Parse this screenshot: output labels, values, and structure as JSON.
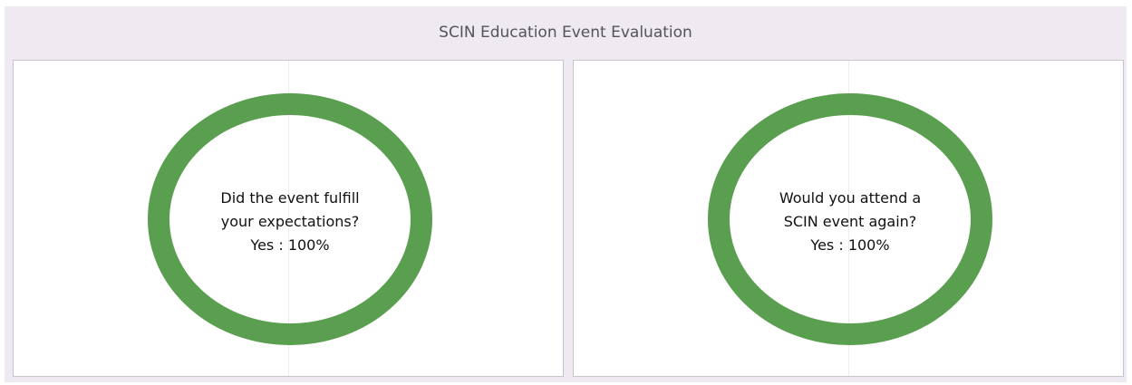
{
  "dashboard": {
    "title": "SCIN Education Event Evaluation"
  },
  "colors": {
    "ring": "#5a9e4f",
    "background": "#efe9f2"
  },
  "chart_data": [
    {
      "type": "pie",
      "question_lines": [
        "Did the event fulfill",
        "your expectations?"
      ],
      "result_text": "Yes : 100%",
      "slices": [
        {
          "label": "Yes",
          "value": 100
        }
      ]
    },
    {
      "type": "pie",
      "question_lines": [
        "Would you attend a",
        "SCIN event again?"
      ],
      "result_text": "Yes : 100%",
      "slices": [
        {
          "label": "Yes",
          "value": 100
        }
      ]
    }
  ]
}
